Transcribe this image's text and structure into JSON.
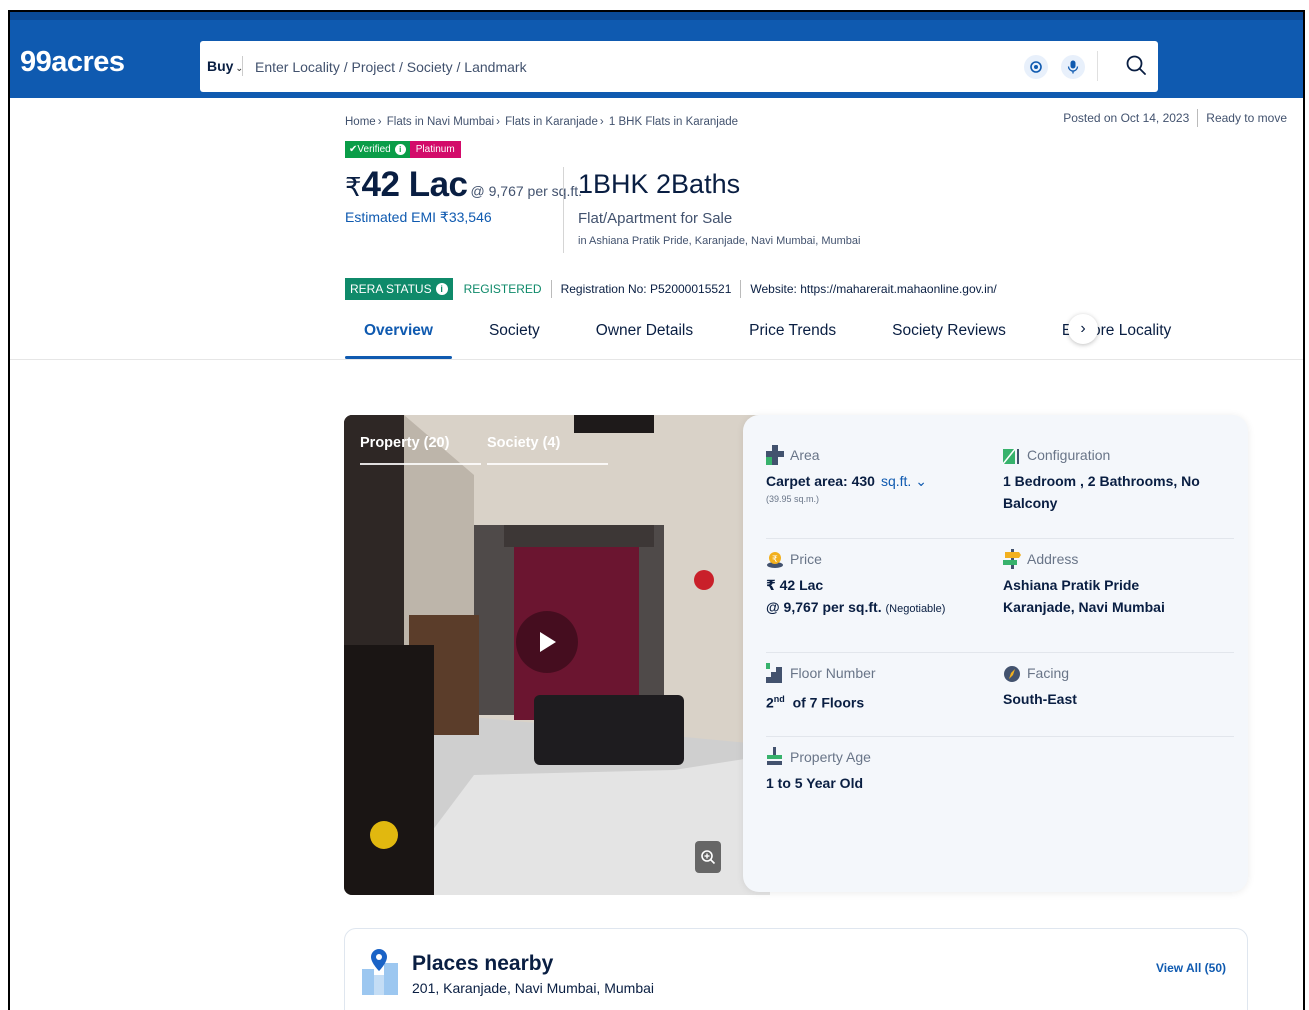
{
  "header": {
    "logo": "99acres",
    "buy_label": "Buy",
    "search_placeholder": "Enter Locality / Project / Society / Landmark"
  },
  "breadcrumb": [
    "Home",
    "Flats in Navi Mumbai",
    "Flats in Karanjade",
    "1 BHK Flats in Karanjade"
  ],
  "posted": {
    "date": "Posted on Oct 14, 2023",
    "status": "Ready to move"
  },
  "badges": {
    "verified": "Verified",
    "tier": "Platinum"
  },
  "price": {
    "currency": "₹",
    "value": "42 Lac",
    "per_sqft": "@ 9,767 per sq.ft.",
    "emi": "Estimated EMI ₹33,546"
  },
  "listing": {
    "title": "1BHK 2Baths",
    "type": "Flat/Apartment for Sale",
    "location": "in Ashiana Pratik Pride, Karanjade, Navi Mumbai, Mumbai"
  },
  "rera": {
    "status_label": "RERA STATUS",
    "status_value": "REGISTERED",
    "registration": "Registration No: P52000015521",
    "website": "Website: https://maharerait.mahaonline.gov.in/"
  },
  "tabs": [
    "Overview",
    "Society",
    "Owner Details",
    "Price Trends",
    "Society Reviews",
    "Explore Locality"
  ],
  "gallery": {
    "tabs": [
      "Property (20)",
      "Society (4)"
    ]
  },
  "details": {
    "area": {
      "label": "Area",
      "value": "Carpet area: 430",
      "unit": "sq.ft.",
      "sub": "(39.95 sq.m.)"
    },
    "configuration": {
      "label": "Configuration",
      "value": "1 Bedroom , 2 Bathrooms, No Balcony"
    },
    "price": {
      "label": "Price",
      "value": "₹ 42 Lac",
      "per": "@ 9,767 per sq.ft.",
      "note": "(Negotiable)"
    },
    "address": {
      "label": "Address",
      "line1": "Ashiana Pratik Pride",
      "line2": "Karanjade, Navi Mumbai"
    },
    "floor": {
      "label": "Floor Number",
      "value_num": "2",
      "value_sup": "nd",
      "value_rest": "of 7 Floors"
    },
    "facing": {
      "label": "Facing",
      "value": "South-East"
    },
    "age": {
      "label": "Property Age",
      "value": "1 to 5 Year Old"
    }
  },
  "places": {
    "title": "Places nearby",
    "address": "201, Karanjade, Navi Mumbai, Mumbai",
    "view_all": "View All (50)"
  },
  "colors": {
    "brand_blue": "#0f5ab0",
    "verified_green": "#0a9d48",
    "platinum_pink": "#d30b6a",
    "rera_green": "#0f8a6a"
  }
}
